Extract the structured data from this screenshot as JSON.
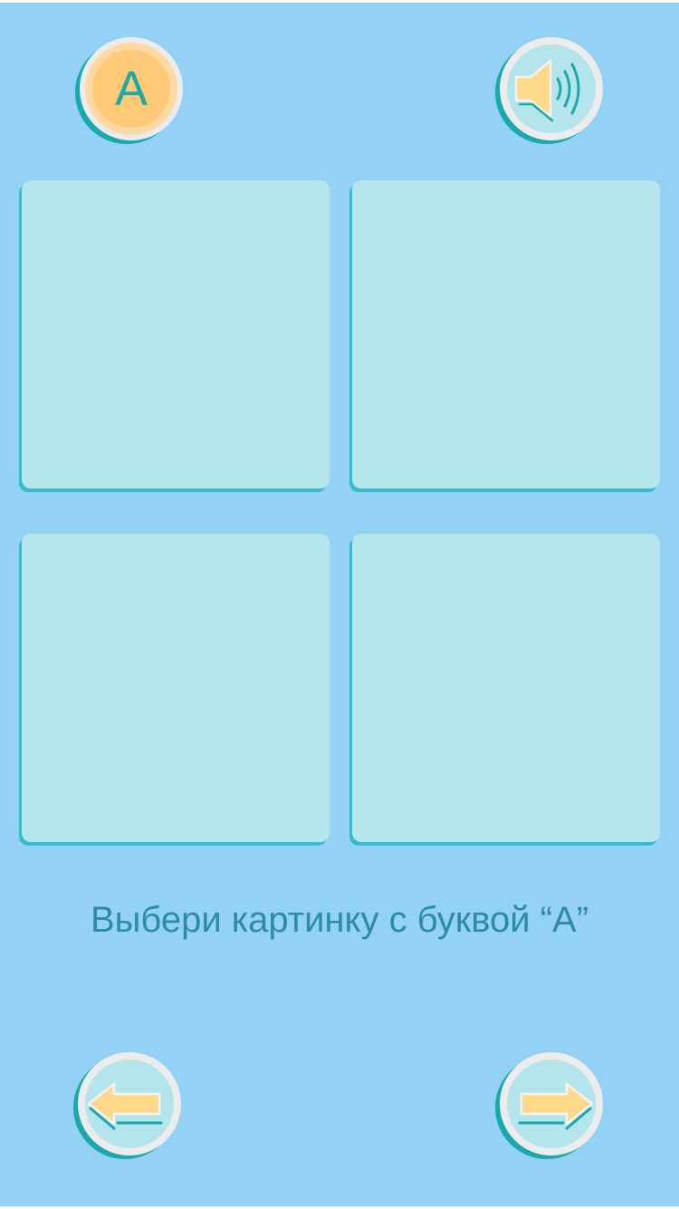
{
  "header": {
    "letter": "А",
    "sound_icon": "speaker-icon"
  },
  "cards": [
    "",
    "",
    "",
    ""
  ],
  "instruction": "Выбери картинку с буквой “А”",
  "nav": {
    "back_icon": "arrow-left-icon",
    "next_icon": "arrow-right-icon"
  },
  "colors": {
    "background": "#94d2f5",
    "card": "#b5e6ec",
    "accent": "#1aa8ab",
    "text": "#2c8da2",
    "letter_badge": "#ffc978"
  }
}
